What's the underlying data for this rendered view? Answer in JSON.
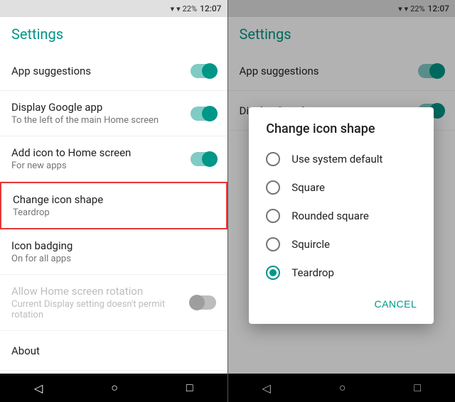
{
  "leftPanel": {
    "statusBar": {
      "signal": "▼",
      "battery": "22%",
      "time": "12:07"
    },
    "header": {
      "title": "Settings"
    },
    "items": [
      {
        "id": "app-suggestions",
        "title": "App suggestions",
        "subtitle": "",
        "toggle": "on",
        "disabled": false,
        "highlighted": false
      },
      {
        "id": "display-google-app",
        "title": "Display Google app",
        "subtitle": "To the left of the main Home screen",
        "toggle": "on",
        "disabled": false,
        "highlighted": false
      },
      {
        "id": "add-icon",
        "title": "Add icon to Home screen",
        "subtitle": "For new apps",
        "toggle": "on",
        "disabled": false,
        "highlighted": false
      },
      {
        "id": "change-icon-shape",
        "title": "Change icon shape",
        "subtitle": "Teardrop",
        "toggle": null,
        "disabled": false,
        "highlighted": true
      },
      {
        "id": "icon-badging",
        "title": "Icon badging",
        "subtitle": "On for all apps",
        "toggle": null,
        "disabled": false,
        "highlighted": false
      },
      {
        "id": "home-rotation",
        "title": "Allow Home screen rotation",
        "subtitle": "Current Display setting doesn't permit rotation",
        "toggle": "off",
        "disabled": true,
        "highlighted": false
      },
      {
        "id": "about",
        "title": "About",
        "subtitle": "",
        "toggle": null,
        "disabled": false,
        "highlighted": false
      }
    ],
    "navBar": {
      "back": "◁",
      "home": "○",
      "recents": "□"
    }
  },
  "rightPanel": {
    "statusBar": {
      "signal": "▼",
      "battery": "22%",
      "time": "12:07"
    },
    "header": {
      "title": "Settings"
    },
    "items": [
      {
        "id": "app-suggestions-r",
        "title": "App suggestions",
        "toggle": "on"
      },
      {
        "id": "display-google-app-r",
        "title": "Display Google app",
        "toggle": "on"
      }
    ],
    "dialog": {
      "title": "Change icon shape",
      "options": [
        {
          "id": "use-system-default",
          "label": "Use system default",
          "selected": false
        },
        {
          "id": "square",
          "label": "Square",
          "selected": false
        },
        {
          "id": "rounded-square",
          "label": "Rounded square",
          "selected": false
        },
        {
          "id": "squircle",
          "label": "Squircle",
          "selected": false
        },
        {
          "id": "teardrop",
          "label": "Teardrop",
          "selected": true
        }
      ],
      "cancelLabel": "CANCEL"
    },
    "navBar": {
      "back": "◁",
      "home": "○",
      "recents": "□"
    }
  }
}
